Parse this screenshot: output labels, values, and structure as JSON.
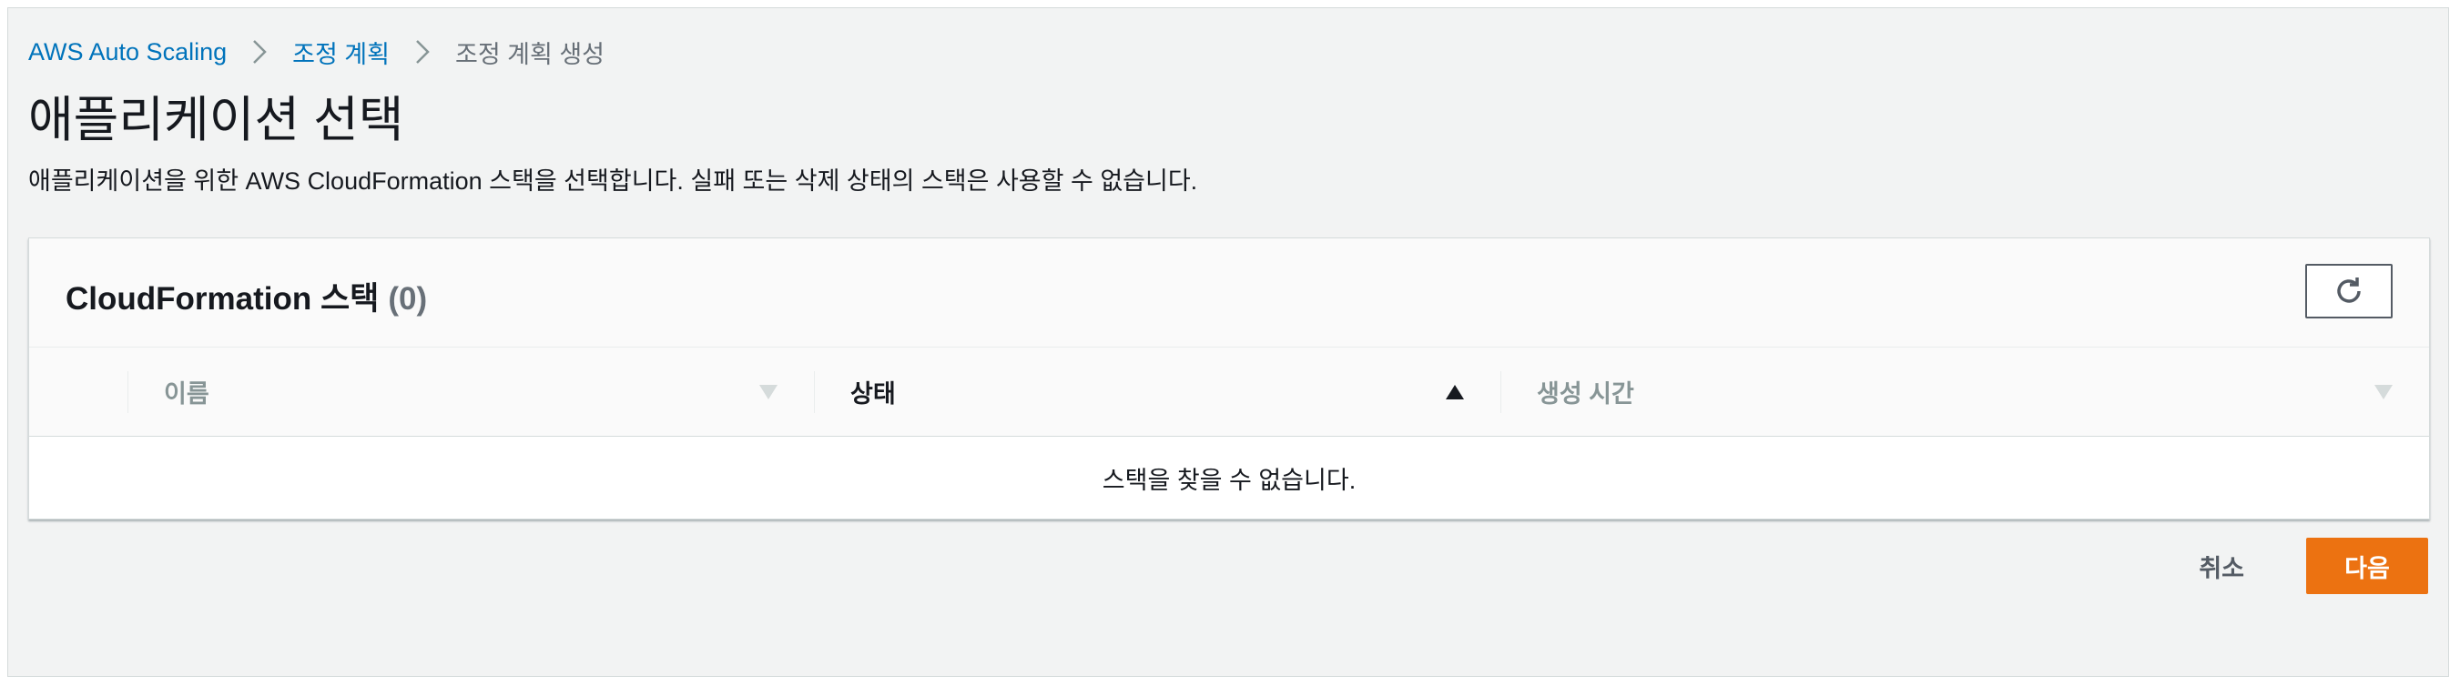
{
  "breadcrumb": {
    "items": [
      {
        "label": "AWS Auto Scaling"
      },
      {
        "label": "조정 계획"
      },
      {
        "label": "조정 계획 생성"
      }
    ]
  },
  "page": {
    "title": "애플리케이션 선택",
    "description": "애플리케이션을 위한 AWS CloudFormation 스택을 선택합니다. 실패 또는 삭제 상태의 스택은 사용할 수 없습니다."
  },
  "stacks_panel": {
    "title": "CloudFormation 스택",
    "count": "(0)",
    "refresh_icon": "refresh-icon",
    "columns": [
      {
        "label": "이름",
        "sort": "none"
      },
      {
        "label": "상태",
        "sort": "ascending"
      },
      {
        "label": "생성 시간",
        "sort": "none"
      }
    ],
    "empty_message": "스택을 찾을 수 없습니다."
  },
  "actions": {
    "cancel_label": "취소",
    "next_label": "다음"
  },
  "colors": {
    "link": "#0073bb",
    "primary_button": "#ec7211",
    "background": "#f2f3f3"
  }
}
